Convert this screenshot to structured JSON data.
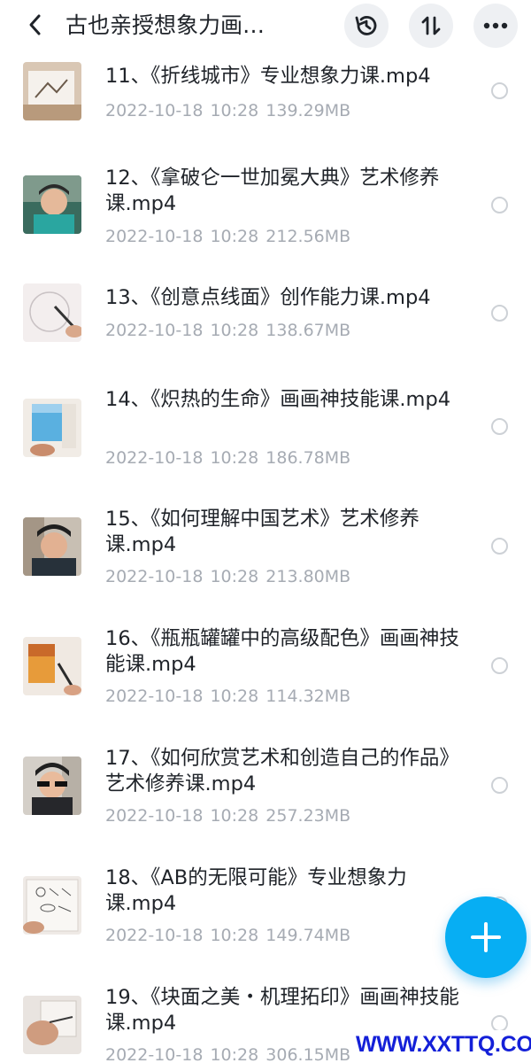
{
  "header": {
    "title": "古也亲授想象力画…",
    "icons": [
      "back-arrow-icon",
      "history-icon",
      "sort-icon",
      "more-icon"
    ]
  },
  "files": [
    {
      "name": "11、《折线城市》专业想象力课.mp4",
      "date": "2022-10-18",
      "time": "10:28",
      "size": "139.29MB",
      "thumb": "paper-drawing"
    },
    {
      "name": "12、《拿破仑一世加冕大典》艺术修养课.mp4",
      "date": "2022-10-18",
      "time": "10:28",
      "size": "212.56MB",
      "thumb": "speaker"
    },
    {
      "name": "13、《创意点线面》创作能力课.mp4",
      "date": "2022-10-18",
      "time": "10:28",
      "size": "138.67MB",
      "thumb": "pen-drawing"
    },
    {
      "name": "14、《炽热的生命》画画神技能课.mp4",
      "date": "2022-10-18",
      "time": "10:28",
      "size": "186.78MB",
      "thumb": "blue-painting"
    },
    {
      "name": "15、《如何理解中国艺术》艺术修养课.mp4",
      "date": "2022-10-18",
      "time": "10:28",
      "size": "213.80MB",
      "thumb": "speaker"
    },
    {
      "name": "16、《瓶瓶罐罐中的高级配色》画画神技能课.mp4",
      "date": "2022-10-18",
      "time": "10:28",
      "size": "114.32MB",
      "thumb": "orange-painting"
    },
    {
      "name": "17、《如何欣赏艺术和创造自己的作品》艺术修养课.mp4",
      "date": "2022-10-18",
      "time": "10:28",
      "size": "257.23MB",
      "thumb": "speaker"
    },
    {
      "name": "18、《AB的无限可能》专业想象力课.mp4",
      "date": "2022-10-18",
      "time": "10:28",
      "size": "149.74MB",
      "thumb": "sketch-sheet"
    },
    {
      "name": "19、《块面之美・机理拓印》画画神技能课.mp4",
      "date": "2022-10-18",
      "time": "10:28",
      "size": "306.15MB",
      "thumb": "hand-print"
    }
  ],
  "fab": {
    "icon": "plus-icon"
  },
  "watermark": {
    "text": "WWW.XXTTQ.COM"
  },
  "colors": {
    "accent": "#07aef3",
    "meta_text": "#a6abb3",
    "title_text": "#1f2329",
    "watermark": "#1420d8"
  }
}
